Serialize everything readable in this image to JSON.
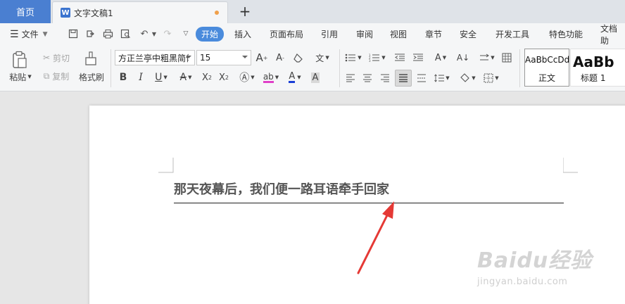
{
  "tabs": {
    "home": "首页",
    "document": "文字文稿1",
    "doc_icon_letter": "W",
    "add_symbol": "+"
  },
  "menu": {
    "file": "文件",
    "items": [
      "开始",
      "插入",
      "页面布局",
      "引用",
      "审阅",
      "视图",
      "章节",
      "安全",
      "开发工具",
      "特色功能",
      "文档助"
    ],
    "active": "开始"
  },
  "ribbon": {
    "paste": "粘贴",
    "cut": "剪切",
    "copy": "复制",
    "format_painter": "格式刷",
    "font_name": "方正兰亭中粗黑简体",
    "font_size": "15",
    "styles": [
      {
        "sample": "AaBbCcDd",
        "name": "正文"
      },
      {
        "sample": "AaBb",
        "name": "标题 1"
      }
    ]
  },
  "document": {
    "line1": "那天夜幕后，我们便一路耳语牵手回家"
  },
  "watermark": {
    "logo": "Baidu经验",
    "url": "jingyan.baidu.com"
  },
  "colors": {
    "home_tab": "#4a7fd1",
    "active_menu": "#4a8bdc",
    "arrow": "#e53935",
    "font_color_bar": "#1a3fd6",
    "highlight_bar": "#e040c8"
  }
}
